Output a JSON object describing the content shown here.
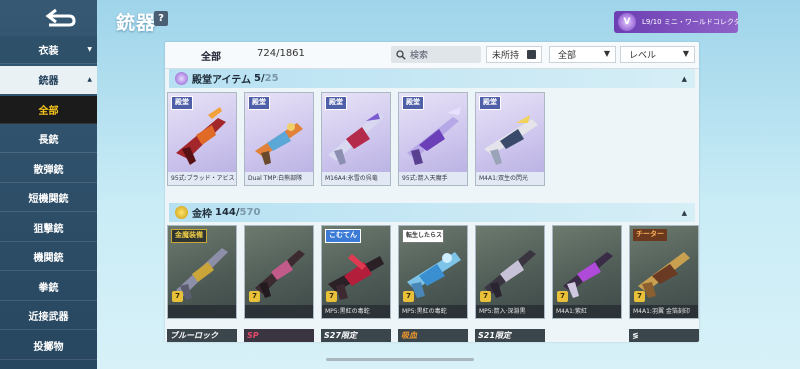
{
  "header": {
    "title": "銃器",
    "help": "?",
    "collection_label": "L9/10 ミニ・ワールドコレクタ",
    "collection_emblem": "V"
  },
  "sidebar": {
    "items": [
      {
        "label": "衣装",
        "caret": "▼"
      },
      {
        "label": "銃器",
        "caret": "▲"
      },
      {
        "label": "全部"
      },
      {
        "label": "長銃"
      },
      {
        "label": "散弾銃"
      },
      {
        "label": "短機関銃"
      },
      {
        "label": "狙撃銃"
      },
      {
        "label": "機関銃"
      },
      {
        "label": "拳銃"
      },
      {
        "label": "近接武器"
      },
      {
        "label": "投擲物"
      }
    ]
  },
  "toolbar": {
    "all_label": "全部",
    "count": "724/1861",
    "search_placeholder": "検索",
    "owned_filter": "未所持",
    "category_select": "全部",
    "sort_select": "レベル",
    "chevron": "▼"
  },
  "sections": [
    {
      "name": "殿堂アイテム",
      "count": "5/",
      "total": "25",
      "caret": "▲"
    },
    {
      "name": "金枠",
      "count": "144/",
      "total": "570",
      "caret": "▲"
    }
  ],
  "legend_cards": [
    {
      "tag": "殿堂",
      "caption": "95式:ブラッド・アビス"
    },
    {
      "tag": "殿堂",
      "caption": "Dual TMP:白熊部隊"
    },
    {
      "tag": "殿堂",
      "caption": "M16A4:氷雪の呉竜"
    },
    {
      "tag": "殿堂",
      "caption": "95式:箭入天魔手"
    },
    {
      "tag": "殿堂",
      "caption": "M4A1:双生の閃光"
    }
  ],
  "gold_cards": [
    {
      "tag": "金魔装備",
      "rank": "7",
      "caption": ""
    },
    {
      "tag": "",
      "rank": "7",
      "caption": ""
    },
    {
      "tag": "こむてん",
      "rank": "7",
      "caption": "MP5:黒紅の毒蛇"
    },
    {
      "tag": "転生したらスライムだった件",
      "rank": "7",
      "caption": "MP5:黒紅の毒蛇"
    },
    {
      "tag": "",
      "rank": "7",
      "caption": "MP5:箭入·深淵黒"
    },
    {
      "tag": "",
      "rank": "7",
      "caption": "M4A1:紫紅"
    },
    {
      "tag": "チーター",
      "rank": "7",
      "caption": "M4A1:羽翼 金箔刻印"
    }
  ],
  "next_row": [
    "ブルーロック",
    "SP",
    "S27限定",
    "吸血",
    "S21限定",
    "≶"
  ],
  "colors": {
    "sidebar": "#2f5069",
    "active_text": "#f5c51a",
    "legend_card": "#cbc3ec",
    "gold_card": "#4d5a55",
    "collection_badge": "#7b4fbf"
  }
}
